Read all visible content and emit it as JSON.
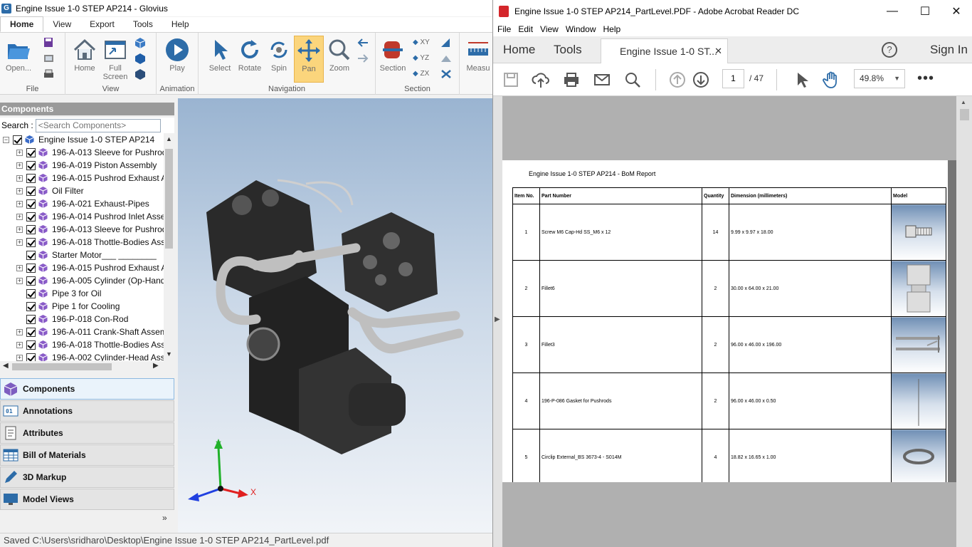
{
  "glovius": {
    "title": "Engine Issue 1-0 STEP AP214 - Glovius",
    "app_icon_letter": "G",
    "menu_tabs": [
      "Home",
      "View",
      "Export",
      "Tools",
      "Help"
    ],
    "ribbon": {
      "buttons": {
        "open": "Open...",
        "home": "Home",
        "full_screen_1": "Full",
        "full_screen_2": "Screen",
        "play": "Play",
        "select": "Select",
        "rotate": "Rotate",
        "spin": "Spin",
        "pan": "Pan",
        "zoom": "Zoom",
        "section": "Section",
        "measure": "Measu",
        "xy": "XY",
        "yz": "YZ",
        "zx": "ZX"
      },
      "groups": {
        "file": "File",
        "view": "View",
        "animation": "Animation",
        "navigation": "Navigation",
        "section": "Section"
      }
    },
    "components_header": "Components",
    "search_label": "Search :",
    "search_placeholder": "<Search Components>",
    "tree": [
      {
        "label": "Engine Issue 1-0 STEP AP214",
        "expander": "−",
        "indent": 0
      },
      {
        "label": "196-A-013 Sleeve for Pushrod",
        "expander": "+",
        "indent": 1
      },
      {
        "label": "196-A-019 Piston Assembly",
        "expander": "+",
        "indent": 1
      },
      {
        "label": "196-A-015 Pushrod Exhaust A",
        "expander": "+",
        "indent": 1
      },
      {
        "label": "Oil Filter",
        "expander": "+",
        "indent": 1
      },
      {
        "label": "196-A-021 Exhaust-Pipes",
        "expander": "+",
        "indent": 1
      },
      {
        "label": "196-A-014 Pushrod Inlet Asser",
        "expander": "+",
        "indent": 1
      },
      {
        "label": "196-A-013 Sleeve for Pushrod",
        "expander": "+",
        "indent": 1
      },
      {
        "label": "196-A-018 Thottle-Bodies Ass",
        "expander": "+",
        "indent": 1
      },
      {
        "label": "Starter Motor___ ________",
        "expander": "",
        "indent": 1
      },
      {
        "label": "196-A-015 Pushrod Exhaust A",
        "expander": "+",
        "indent": 1
      },
      {
        "label": "196-A-005 Cylinder (Op-Hand",
        "expander": "+",
        "indent": 1
      },
      {
        "label": "Pipe 3 for Oil",
        "expander": "",
        "indent": 1
      },
      {
        "label": "Pipe 1 for Cooling",
        "expander": "",
        "indent": 1
      },
      {
        "label": "196-P-018 Con-Rod",
        "expander": "",
        "indent": 1
      },
      {
        "label": "196-A-011 Crank-Shaft Assem",
        "expander": "+",
        "indent": 1
      },
      {
        "label": "196-A-018 Thottle-Bodies Ass",
        "expander": "+",
        "indent": 1
      },
      {
        "label": "196-A-002 Cylinder-Head Ass",
        "expander": "+",
        "indent": 1
      }
    ],
    "side_tabs": [
      "Components",
      "Annotations",
      "Attributes",
      "Bill of Materials",
      "3D Markup",
      "Model Views"
    ],
    "axis_labels": {
      "y": "Y",
      "x": "X"
    },
    "status": "Saved C:\\Users\\sridharo\\Desktop\\Engine Issue 1-0 STEP AP214_PartLevel.pdf"
  },
  "acrobat": {
    "title": "Engine Issue 1-0 STEP AP214_PartLevel.PDF - Adobe Acrobat Reader DC",
    "menu": [
      "File",
      "Edit",
      "View",
      "Window",
      "Help"
    ],
    "tabs": {
      "home": "Home",
      "tools": "Tools",
      "doc": "Engine Issue 1-0 ST...",
      "sign_in": "Sign In"
    },
    "page_current": "1",
    "page_total": "/ 47",
    "zoom": "49.8%",
    "report_title": "Engine Issue 1-0 STEP AP214 - BoM Report",
    "bom_headers": [
      "Item No.",
      "Part Number",
      "Quantity",
      "Dimension (millimeters)",
      "Model"
    ],
    "bom_rows": [
      {
        "item": "1",
        "part": "Screw M6 Cap-Hd SS_M6 x 12",
        "qty": "14",
        "dim": "9.99 x 9.97 x 18.00"
      },
      {
        "item": "2",
        "part": "Fillet6",
        "qty": "2",
        "dim": "30.00 x 64.00 x 21.00"
      },
      {
        "item": "3",
        "part": "Fillet3",
        "qty": "2",
        "dim": "96.00 x 46.00 x 196.00"
      },
      {
        "item": "4",
        "part": "196-P-086 Gasket for Pushrods",
        "qty": "2",
        "dim": "96.00 x 46.00 x 0.50"
      },
      {
        "item": "5",
        "part": "Circlip External_BS 3673-4 - S014M",
        "qty": "4",
        "dim": "18.82 x 16.65 x 1.00"
      }
    ]
  }
}
